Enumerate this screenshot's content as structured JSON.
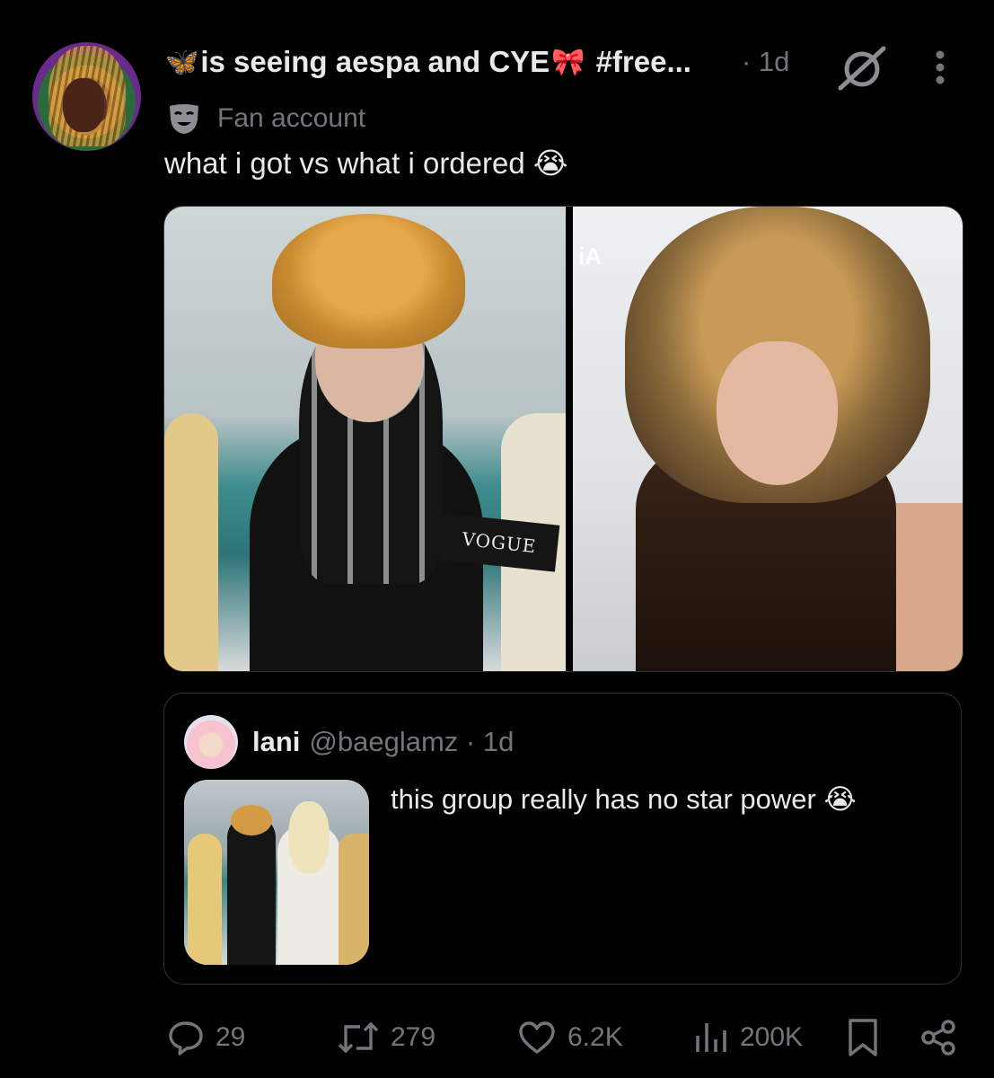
{
  "post": {
    "display_name": "is seeing aespa and CYE",
    "display_name_prefix_emoji": "🦋",
    "display_name_mid_emoji": "🎀",
    "display_name_suffix": "#free...",
    "time": "· 1d",
    "label": "Fan account",
    "text": "what i got vs what i ordered 😭",
    "media_text_left": "VOGUE",
    "media_text_right": "iA"
  },
  "quote": {
    "name": "lani",
    "meta": "@baeglamz · 1d",
    "text": "this group really has no star power 😭"
  },
  "actions": {
    "replies": "29",
    "reposts": "279",
    "likes": "6.2K",
    "views": "200K"
  },
  "icons": [
    "grok-icon",
    "more-icon",
    "fan-account-mask-icon",
    "reply-icon",
    "repost-icon",
    "like-icon",
    "views-icon",
    "bookmark-icon",
    "share-icon"
  ],
  "colors": {
    "background": "#000000",
    "primary_text": "#e7e9ea",
    "secondary_text": "#71767b",
    "border": "#2f3336"
  }
}
